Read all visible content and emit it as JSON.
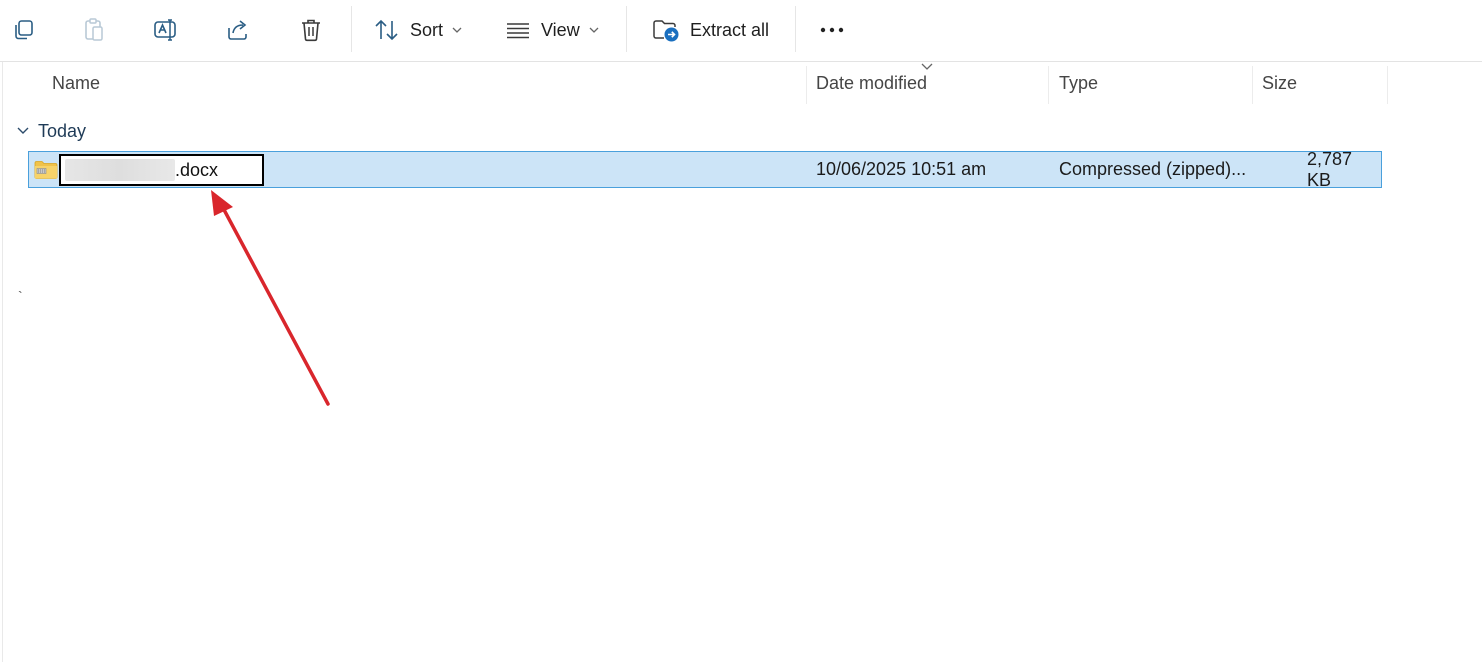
{
  "toolbar": {
    "copy_icon": "copy-icon",
    "paste_icon": "paste-icon",
    "rename_icon": "rename-icon",
    "share_icon": "share-icon",
    "delete_icon": "trash-icon",
    "sort_label": "Sort",
    "view_label": "View",
    "extract_label": "Extract all",
    "more_icon": "more-icon"
  },
  "columns": {
    "name": "Name",
    "date": "Date modified",
    "type": "Type",
    "size": "Size"
  },
  "group": {
    "label": "Today"
  },
  "files": [
    {
      "name_ext": ".docx",
      "date": "10/06/2025 10:51 am",
      "type": "Compressed (zipped)...",
      "size": "2,787 KB"
    }
  ],
  "stray_mark": "`",
  "colors": {
    "selection_bg": "#cce4f7",
    "selection_border": "#4aa0dc",
    "annotation_arrow": "#d9262c"
  }
}
